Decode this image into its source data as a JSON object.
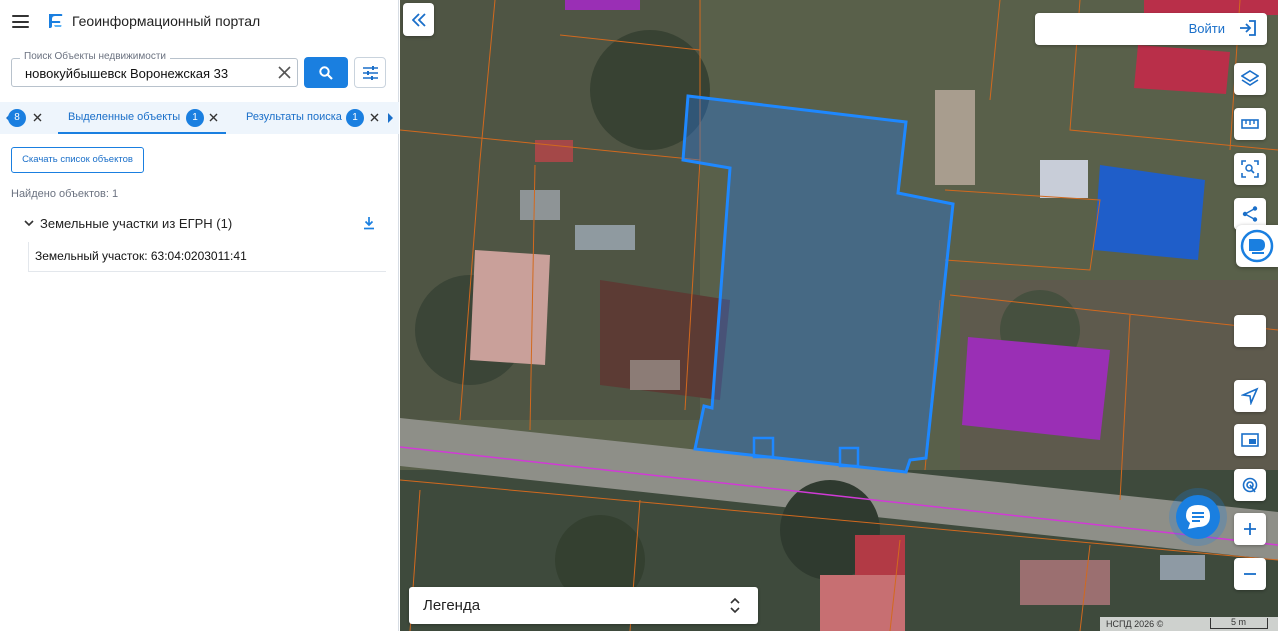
{
  "app": {
    "title": "Геоинформационный портал"
  },
  "search": {
    "label": "Поиск Объекты недвижимости",
    "value": "новокуйбышевск Воронежская 33"
  },
  "tabs": [
    {
      "badge": "8"
    },
    {
      "label": "Выделенные объекты",
      "badge": "1"
    },
    {
      "label": "Результаты поиска",
      "badge": "1"
    }
  ],
  "actions": {
    "download_list_label": "Скачать список объектов"
  },
  "results": {
    "found_text": "Найдено объектов: 1",
    "group_label": "Земельные участки из ЕГРН (1)",
    "items": [
      {
        "label": "Земельный участок: 63:04:0203011:41"
      }
    ]
  },
  "map": {
    "login_label": "Войти",
    "legend_label": "Легенда",
    "attribution": "НСПД 2026 ©",
    "scale_label": "5 m"
  },
  "icons": {
    "menu": "menu-icon",
    "logo": "logo-icon",
    "search": "search-icon",
    "clear": "close-icon",
    "filter": "filter-icon",
    "download": "download-icon",
    "login": "login-icon",
    "layers": "layers-icon",
    "ruler": "ruler-icon",
    "select": "select-area-icon",
    "share": "share-icon",
    "locate": "navigation-icon",
    "minimap": "minimap-icon",
    "fingerprint": "fingerprint-icon",
    "zoom_in": "plus-icon",
    "zoom_out": "minus-icon",
    "chat": "chat-icon"
  },
  "colors": {
    "accent": "#1a7fe0",
    "parcel_outline": "#1e88ff",
    "cadastral_lines": "#d2691e"
  }
}
